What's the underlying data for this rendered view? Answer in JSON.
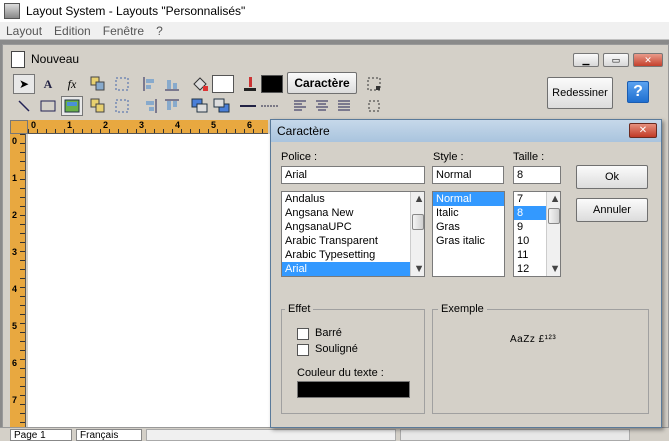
{
  "app": {
    "title": "Layout System - Layouts \"Personnalisés\""
  },
  "menu": [
    "Layout",
    "Edition",
    "Fenêtre",
    "?"
  ],
  "document": {
    "title": "Nouveau"
  },
  "toolbar": {
    "caractere_label": "Caractère",
    "redessiner_label": "Redessiner",
    "help_label": "?",
    "text_tool": "A",
    "function_tool": "fx"
  },
  "ruler": {
    "h_labels": [
      "0",
      "1",
      "2",
      "3",
      "4",
      "5",
      "6"
    ],
    "v_labels": [
      "0",
      "1",
      "2",
      "3",
      "4",
      "5",
      "6",
      "7"
    ]
  },
  "dialog": {
    "title": "Caractère",
    "close_label": "✕",
    "police_label": "Police :",
    "police_value": "Arial",
    "style_label": "Style :",
    "style_value": "Normal",
    "taille_label": "Taille :",
    "taille_value": "8",
    "fonts": [
      {
        "name": "Andalus",
        "selected": false
      },
      {
        "name": "Angsana New",
        "selected": false
      },
      {
        "name": "AngsanaUPC",
        "selected": false
      },
      {
        "name": "Arabic Transparent",
        "selected": false
      },
      {
        "name": "Arabic Typesetting",
        "selected": false
      },
      {
        "name": "Arial",
        "selected": true
      }
    ],
    "styles": [
      {
        "name": "Normal",
        "selected": true
      },
      {
        "name": "Italic",
        "selected": false
      },
      {
        "name": "Gras",
        "selected": false
      },
      {
        "name": "Gras italic",
        "selected": false
      }
    ],
    "sizes": [
      {
        "name": "7",
        "selected": false
      },
      {
        "name": "8",
        "selected": true
      },
      {
        "name": "9",
        "selected": false
      },
      {
        "name": "10",
        "selected": false
      },
      {
        "name": "11",
        "selected": false
      },
      {
        "name": "12",
        "selected": false
      }
    ],
    "ok_label": "Ok",
    "annuler_label": "Annuler",
    "effet_label": "Effet",
    "barre_label": "Barré",
    "souligne_label": "Souligné",
    "couleur_label": "Couleur du texte :",
    "couleur_value": "#000000",
    "exemple_label": "Exemple",
    "exemple_text": "AaZz £¹²³"
  },
  "statusbar": {
    "page": "Page 1",
    "language": "Français"
  },
  "colors": {
    "selection": "#3399ff",
    "ruler": "#e8a840",
    "help_blue": "#2a7de1"
  }
}
